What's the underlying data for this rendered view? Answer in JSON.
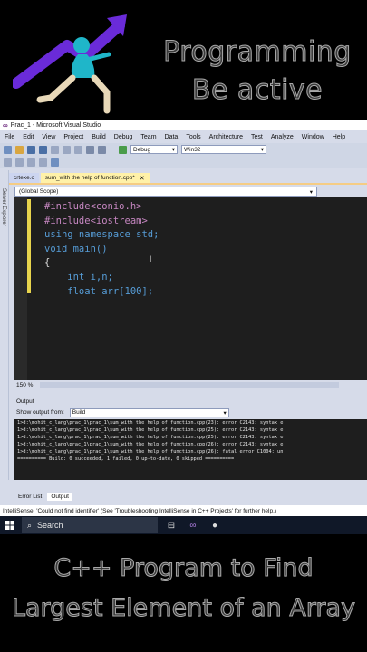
{
  "banner": {
    "line1": "Programming",
    "line2": "Be active"
  },
  "window": {
    "title": "Prac_1 - Microsoft Visual Studio"
  },
  "menu": [
    "File",
    "Edit",
    "View",
    "Project",
    "Build",
    "Debug",
    "Team",
    "Data",
    "Tools",
    "Architecture",
    "Test",
    "Analyze",
    "Window",
    "Help"
  ],
  "toolbar": {
    "config": "Debug",
    "platform": "Win32"
  },
  "left_strip": {
    "label": "Server Explorer"
  },
  "tabs": [
    {
      "label": "crtexe.c"
    },
    {
      "label": "sum_with the help of function.cpp*"
    }
  ],
  "scope": "(Global Scope)",
  "code": [
    "#include<conio.h>",
    "#include<iostream>",
    "using namespace std;",
    "void main()",
    "{",
    "    int i,n;",
    "    float arr[100];"
  ],
  "zoom": "150 %",
  "output": {
    "title": "Output",
    "show_label": "Show output from:",
    "source": "Build",
    "lines": [
      "1>d:\\mohit_c_lang\\prac_1\\prac_1\\sum_with the help of function.cpp(23): error C2143: syntax e",
      "1>d:\\mohit_c_lang\\prac_1\\prac_1\\sum_with the help of function.cpp(25): error C2143: syntax e",
      "1>d:\\mohit_c_lang\\prac_1\\prac_1\\sum_with the help of function.cpp(25): error C2143: syntax e",
      "1>d:\\mohit_c_lang\\prac_1\\prac_1\\sum_with the help of function.cpp(26): error C2143: syntax e",
      "1>d:\\mohit_c_lang\\prac_1\\prac_1\\sum_with the help of function.cpp(26): fatal error C1004: un",
      "========== Build: 0 succeeded, 1 failed, 0 up-to-date, 0 skipped =========="
    ]
  },
  "bottom_tabs": [
    "Error List",
    "Output"
  ],
  "status": "IntelliSense: 'Could not find identifier' (See 'Troubleshooting IntelliSense in C++ Projects' for further help.)",
  "taskbar": {
    "search": "Search"
  },
  "caption": {
    "line1": "C++ Program to Find",
    "line2": "Largest Element of an Array"
  },
  "colors": {
    "logo_arrow": "#6a2bd9",
    "logo_figure": "#1fb6c9",
    "accent_tab": "#fff1a8",
    "editor_bg": "#1e1e1e",
    "keyword": "#569cd6"
  }
}
